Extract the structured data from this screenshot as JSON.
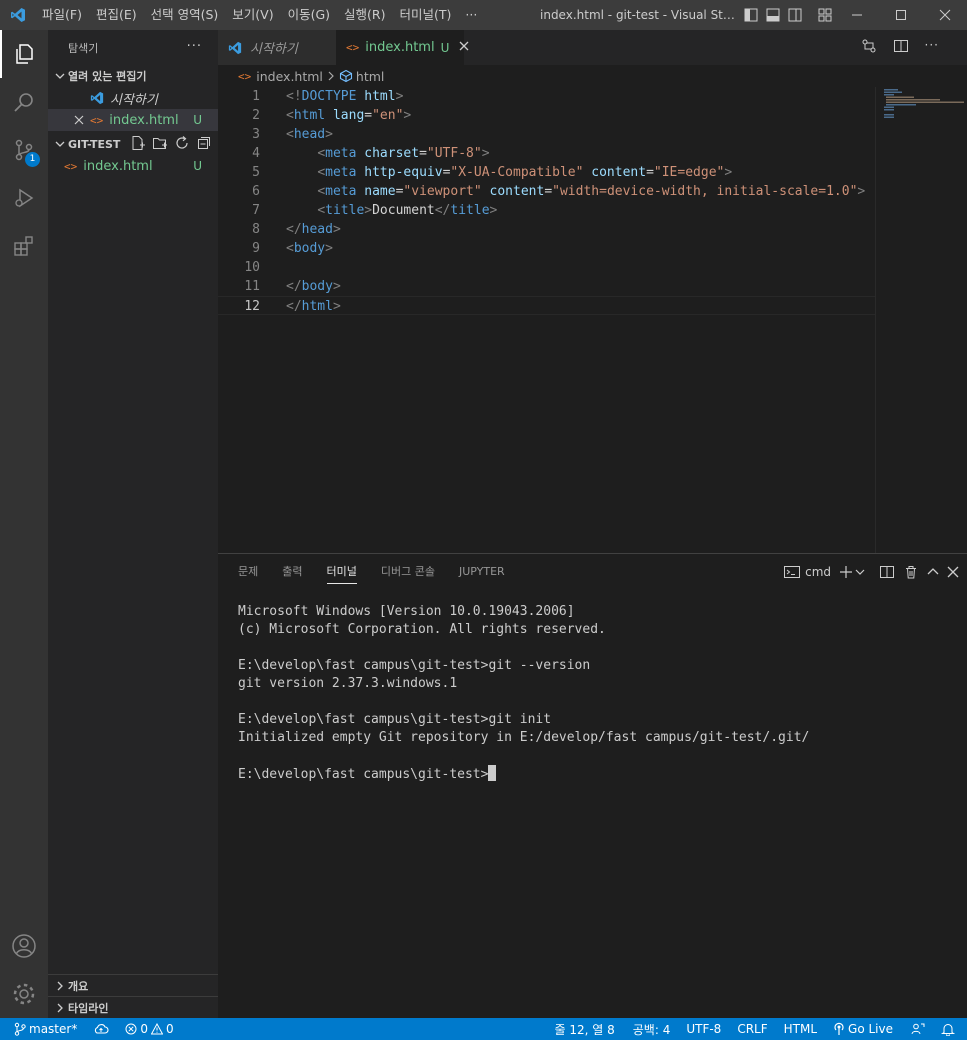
{
  "titlebar": {
    "menu": [
      "파일(F)",
      "편집(E)",
      "선택 영역(S)",
      "보기(V)",
      "이동(G)",
      "실행(R)",
      "터미널(T)",
      "···"
    ],
    "window_title": "index.html - git-test - Visual Studio ..."
  },
  "activity": {
    "scm_badge": "1"
  },
  "sidebar": {
    "title": "탐색기",
    "more": "···",
    "open_editors_label": "열려 있는 편집기",
    "open_editors": [
      {
        "label": "시작하기",
        "status": ""
      },
      {
        "label": "index.html",
        "status": "U"
      }
    ],
    "folder_label": "GIT-TEST",
    "files": [
      {
        "label": "index.html",
        "status": "U"
      }
    ],
    "outline_label": "개요",
    "timeline_label": "타임라인"
  },
  "tabs": [
    {
      "label": "시작하기"
    },
    {
      "label": "index.html",
      "status": "U"
    }
  ],
  "breadcrumb": {
    "file": "index.html",
    "symbol": "html"
  },
  "editor": {
    "current_line": 12,
    "lines": [
      {
        "n": "1",
        "parts": [
          {
            "c": "tg",
            "t": "<!"
          },
          {
            "c": "tn",
            "t": "DOCTYPE"
          },
          {
            "c": "tx",
            "t": " "
          },
          {
            "c": "an",
            "t": "html"
          },
          {
            "c": "tg",
            "t": ">"
          }
        ]
      },
      {
        "n": "2",
        "parts": [
          {
            "c": "tg",
            "t": "<"
          },
          {
            "c": "tn",
            "t": "html"
          },
          {
            "c": "tx",
            "t": " "
          },
          {
            "c": "an",
            "t": "lang"
          },
          {
            "c": "tx",
            "t": "="
          },
          {
            "c": "av",
            "t": "\"en\""
          },
          {
            "c": "tg",
            "t": ">"
          }
        ]
      },
      {
        "n": "3",
        "parts": [
          {
            "c": "tg",
            "t": "<"
          },
          {
            "c": "tn",
            "t": "head"
          },
          {
            "c": "tg",
            "t": ">"
          }
        ]
      },
      {
        "n": "4",
        "parts": [
          {
            "c": "tx",
            "t": "    "
          },
          {
            "c": "tg",
            "t": "<"
          },
          {
            "c": "tn",
            "t": "meta"
          },
          {
            "c": "tx",
            "t": " "
          },
          {
            "c": "an",
            "t": "charset"
          },
          {
            "c": "tx",
            "t": "="
          },
          {
            "c": "av",
            "t": "\"UTF-8\""
          },
          {
            "c": "tg",
            "t": ">"
          }
        ]
      },
      {
        "n": "5",
        "parts": [
          {
            "c": "tx",
            "t": "    "
          },
          {
            "c": "tg",
            "t": "<"
          },
          {
            "c": "tn",
            "t": "meta"
          },
          {
            "c": "tx",
            "t": " "
          },
          {
            "c": "an",
            "t": "http-equiv"
          },
          {
            "c": "tx",
            "t": "="
          },
          {
            "c": "av",
            "t": "\"X-UA-Compatible\""
          },
          {
            "c": "tx",
            "t": " "
          },
          {
            "c": "an",
            "t": "content"
          },
          {
            "c": "tx",
            "t": "="
          },
          {
            "c": "av",
            "t": "\"IE=edge\""
          },
          {
            "c": "tg",
            "t": ">"
          }
        ]
      },
      {
        "n": "6",
        "parts": [
          {
            "c": "tx",
            "t": "    "
          },
          {
            "c": "tg",
            "t": "<"
          },
          {
            "c": "tn",
            "t": "meta"
          },
          {
            "c": "tx",
            "t": " "
          },
          {
            "c": "an",
            "t": "name"
          },
          {
            "c": "tx",
            "t": "="
          },
          {
            "c": "av",
            "t": "\"viewport\""
          },
          {
            "c": "tx",
            "t": " "
          },
          {
            "c": "an",
            "t": "content"
          },
          {
            "c": "tx",
            "t": "="
          },
          {
            "c": "av",
            "t": "\"width=device-width, initial-scale=1.0\""
          },
          {
            "c": "tg",
            "t": ">"
          }
        ]
      },
      {
        "n": "7",
        "parts": [
          {
            "c": "tx",
            "t": "    "
          },
          {
            "c": "tg",
            "t": "<"
          },
          {
            "c": "tn",
            "t": "title"
          },
          {
            "c": "tg",
            "t": ">"
          },
          {
            "c": "tx",
            "t": "Document"
          },
          {
            "c": "tg",
            "t": "</"
          },
          {
            "c": "tn",
            "t": "title"
          },
          {
            "c": "tg",
            "t": ">"
          }
        ]
      },
      {
        "n": "8",
        "parts": [
          {
            "c": "tg",
            "t": "</"
          },
          {
            "c": "tn",
            "t": "head"
          },
          {
            "c": "tg",
            "t": ">"
          }
        ]
      },
      {
        "n": "9",
        "parts": [
          {
            "c": "tg",
            "t": "<"
          },
          {
            "c": "tn",
            "t": "body"
          },
          {
            "c": "tg",
            "t": ">"
          }
        ]
      },
      {
        "n": "10",
        "parts": []
      },
      {
        "n": "11",
        "parts": [
          {
            "c": "tg",
            "t": "</"
          },
          {
            "c": "tn",
            "t": "body"
          },
          {
            "c": "tg",
            "t": ">"
          }
        ]
      },
      {
        "n": "12",
        "parts": [
          {
            "c": "tg",
            "t": "</"
          },
          {
            "c": "tn",
            "t": "html"
          },
          {
            "c": "tg",
            "t": ">"
          }
        ]
      }
    ]
  },
  "panel": {
    "tabs": [
      "문제",
      "출력",
      "터미널",
      "디버그 콘솔",
      "JUPYTER"
    ],
    "active_tab": "터미널",
    "shell": "cmd",
    "terminal_lines": [
      "Microsoft Windows [Version 10.0.19043.2006]",
      "(c) Microsoft Corporation. All rights reserved.",
      "",
      "E:\\develop\\fast campus\\git-test>git --version",
      "git version 2.37.3.windows.1",
      "",
      "E:\\develop\\fast campus\\git-test>git init",
      "Initialized empty Git repository in E:/develop/fast campus/git-test/.git/",
      "",
      "E:\\develop\\fast campus\\git-test>"
    ]
  },
  "statusbar": {
    "branch": "master*",
    "errors": "0",
    "warnings": "0",
    "position": "줄 12, 열 8",
    "spaces": "공백: 4",
    "encoding": "UTF-8",
    "eol": "CRLF",
    "language": "HTML",
    "golive": "Go Live"
  },
  "colors": {
    "accent": "#007acc",
    "untracked": "#73c991",
    "html_icon": "#e37933",
    "vscode_blue": "#3b9cdf"
  }
}
